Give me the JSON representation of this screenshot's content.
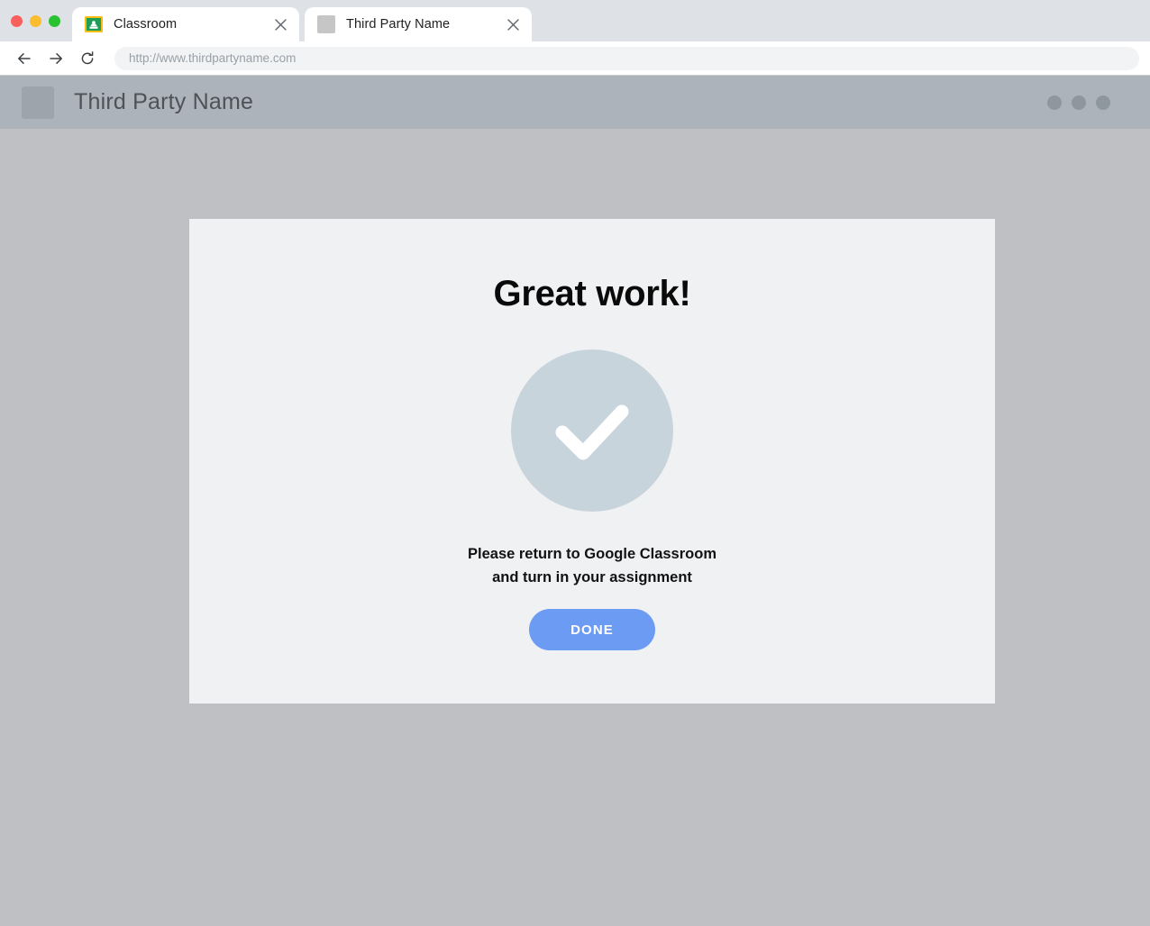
{
  "browser": {
    "window_controls": [
      {
        "name": "close",
        "color": "#f9605b"
      },
      {
        "name": "minimize",
        "color": "#fbbd2e"
      },
      {
        "name": "maximize",
        "color": "#2ac231"
      }
    ],
    "tabs": [
      {
        "title": "Classroom",
        "favicon": "google-classroom-icon",
        "active": false,
        "close_label": "×"
      },
      {
        "title": "Third Party Name",
        "favicon": "placeholder-square-icon",
        "active": true,
        "close_label": "×"
      }
    ],
    "toolbar": {
      "back_label": "←",
      "forward_label": "→",
      "reload_label": "↻",
      "url": "http://www.thirdpartyname.com"
    }
  },
  "site": {
    "header": {
      "logo": "logo-placeholder",
      "name": "Third Party Name",
      "nav_dots": [
        "nav-dot-1",
        "nav-dot-2",
        "nav-dot-3"
      ],
      "background_color": "#acb3bb"
    },
    "page_background_color": "#bec0c3",
    "card": {
      "background_color": "#f0f1f3",
      "title": "Great work!",
      "status_icon": "checkmark-circle-icon",
      "status_icon_color": "#c8d4dc",
      "message_line_1": "Please return to Google Classroom",
      "message_line_2": "and turn in your assignment",
      "done_button_label": "DONE",
      "done_button_color": "#6c9bf4"
    }
  }
}
